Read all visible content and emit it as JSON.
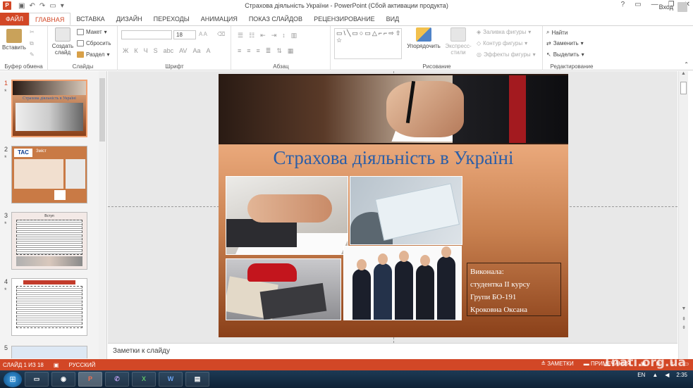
{
  "window": {
    "title": "Страхова діяльність України - PowerPoint (Сбой активации продукта)",
    "app_icon": "P",
    "login": "Вход",
    "controls": [
      "?",
      "▭",
      "—",
      "❐",
      "✕"
    ]
  },
  "ribbon": {
    "tabs": [
      "ФАЙЛ",
      "ГЛАВНАЯ",
      "ВСТАВКА",
      "ДИЗАЙН",
      "ПЕРЕХОДЫ",
      "АНИМАЦИЯ",
      "ПОКАЗ СЛАЙДОВ",
      "РЕЦЕНЗИРОВАНИЕ",
      "ВИД"
    ],
    "clipboard": {
      "group": "Буфер обмена",
      "paste": "Вставить"
    },
    "slides": {
      "group": "Слайды",
      "new_line1": "Создать",
      "new_line2": "слайд",
      "layout": "Макет",
      "reset": "Сбросить",
      "section": "Раздел"
    },
    "font": {
      "group": "Шрифт",
      "size": "18",
      "formats": [
        "Ж",
        "К",
        "Ч",
        "S",
        "abc",
        "AV",
        "Aa",
        "A"
      ]
    },
    "paragraph": {
      "group": "Абзац"
    },
    "drawing": {
      "group": "Рисование",
      "arrange": "Упорядочить",
      "quick_line1": "Экспресс-",
      "quick_line2": "стили",
      "fill": "Заливка фигуры",
      "outline": "Контур фигуры",
      "effects": "Эффекты фигуры"
    },
    "editing": {
      "group": "Редактирование",
      "find": "Найти",
      "replace": "Заменить",
      "select": "Выделить"
    }
  },
  "thumbnails": [
    {
      "num": "1",
      "star": "*",
      "title": "Страхова діяльність в Україні"
    },
    {
      "num": "2",
      "star": "*",
      "title": "Зміст"
    },
    {
      "num": "3",
      "star": "*",
      "title": "Вступ"
    },
    {
      "num": "4",
      "star": "*",
      "title": ""
    },
    {
      "num": "5",
      "star": "",
      "title": ""
    }
  ],
  "slide": {
    "title": "Страхова діяльність в Україні",
    "info": {
      "line1": "Виконала:",
      "line2": "студентка II курсу",
      "line3": "Групи БО-191",
      "line4": "Кроковна Оксана"
    }
  },
  "notes": {
    "placeholder": "Заметки к слайду"
  },
  "status": {
    "slide_count": "СЛАЙД 1 ИЗ 18",
    "language": "РУССКИЙ",
    "notes": "ЗАМЕТКИ",
    "comments": "ПРИМЕЧАНИЯ"
  },
  "taskbar": {
    "apps": [
      "folder",
      "chrome",
      "P",
      "viber",
      "X",
      "W",
      "explorer"
    ],
    "lang": "EN",
    "time": "2:35"
  },
  "watermark": "1nati.org.ua",
  "colors": {
    "accent": "#d24726",
    "title_blue": "#2b5ea7"
  }
}
